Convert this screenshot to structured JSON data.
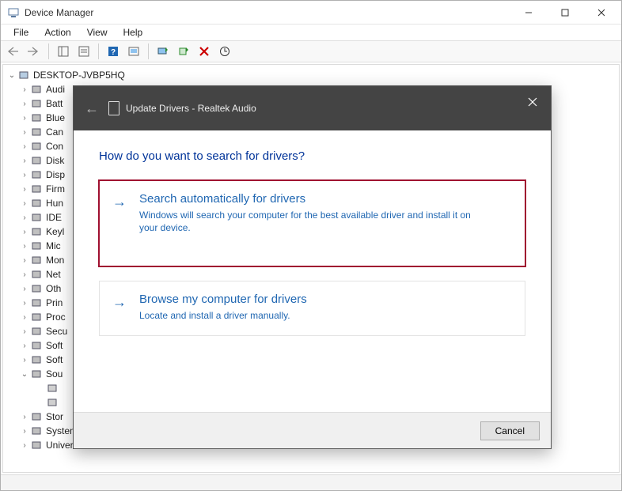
{
  "window": {
    "title": "Device Manager"
  },
  "menu": {
    "file": "File",
    "action": "Action",
    "view": "View",
    "help": "Help"
  },
  "tree": {
    "root": "DESKTOP-JVBP5HQ",
    "items": [
      "Audi",
      "Batt",
      "Blue",
      "Can",
      "Con",
      "Disk",
      "Disp",
      "Firm",
      "Hun",
      "IDE",
      "Keyl",
      "Mic",
      "Mon",
      "Net",
      "Oth",
      "Prin",
      "Proc",
      "Secu",
      "Soft",
      "Soft",
      "Sou"
    ],
    "sou_children": [
      "",
      ""
    ],
    "tail": [
      "Stor",
      "System devices",
      "Universal Serial Bus controllers"
    ]
  },
  "dialog": {
    "title": "Update Drivers - Realtek Audio",
    "heading": "How do you want to search for drivers?",
    "option1": {
      "title": "Search automatically for drivers",
      "desc": "Windows will search your computer for the best available driver and install it on your device."
    },
    "option2": {
      "title": "Browse my computer for drivers",
      "desc": "Locate and install a driver manually."
    },
    "cancel": "Cancel"
  }
}
